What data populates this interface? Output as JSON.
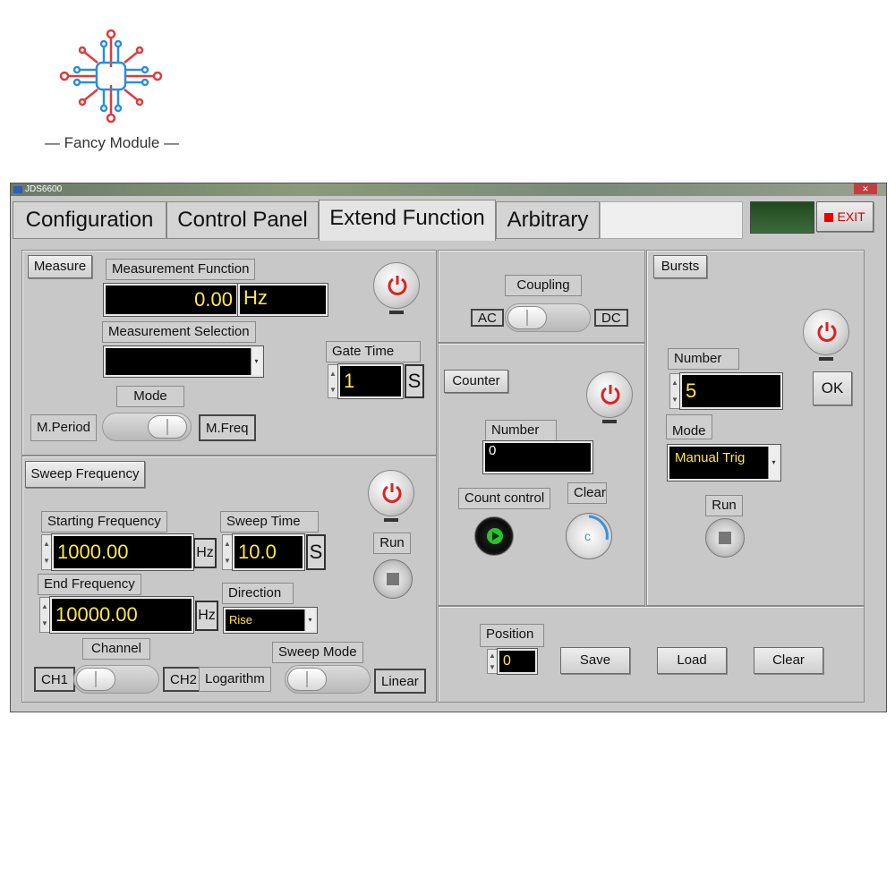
{
  "logo": {
    "text": "Fancy Module"
  },
  "window": {
    "title": "JDS6600",
    "tabs": [
      "Configuration",
      "Control Panel",
      "Extend Function",
      "Arbitrary"
    ],
    "exit_label": "EXIT"
  },
  "measure": {
    "section_label": "Measure",
    "function_label": "Measurement Function",
    "value": "0.00",
    "unit": "Hz",
    "selection_label": "Measurement Selection",
    "selection_value": "",
    "mode_label": "Mode",
    "mode_left": "M.Period",
    "mode_right": "M.Freq",
    "gate_time_label": "Gate Time",
    "gate_time_value": "1",
    "gate_time_unit": "S"
  },
  "coupling": {
    "label": "Coupling",
    "left": "AC",
    "right": "DC"
  },
  "counter": {
    "section_label": "Counter",
    "number_label": "Number",
    "number_value": "0",
    "count_control_label": "Count control",
    "clear_label": "Clear"
  },
  "bursts": {
    "section_label": "Bursts",
    "number_label": "Number",
    "number_value": "5",
    "ok_label": "OK",
    "mode_label": "Mode",
    "mode_value": "Manual Trig",
    "run_label": "Run"
  },
  "sweep": {
    "section_label": "Sweep Frequency",
    "start_label": "Starting Frequency",
    "start_value": "1000.00",
    "start_unit": "Hz",
    "time_label": "Sweep Time",
    "time_value": "10.0",
    "time_unit": "S",
    "end_label": "End Frequency",
    "end_value": "10000.00",
    "end_unit": "Hz",
    "direction_label": "Direction",
    "direction_value": "Rise",
    "run_label": "Run",
    "channel_label": "Channel",
    "ch1": "CH1",
    "ch2": "CH2",
    "mode_label": "Sweep Mode",
    "mode_left": "Logarithm",
    "mode_right": "Linear"
  },
  "storage": {
    "position_label": "Position",
    "position_value": "0",
    "save_label": "Save",
    "load_label": "Load",
    "clear_label": "Clear"
  }
}
